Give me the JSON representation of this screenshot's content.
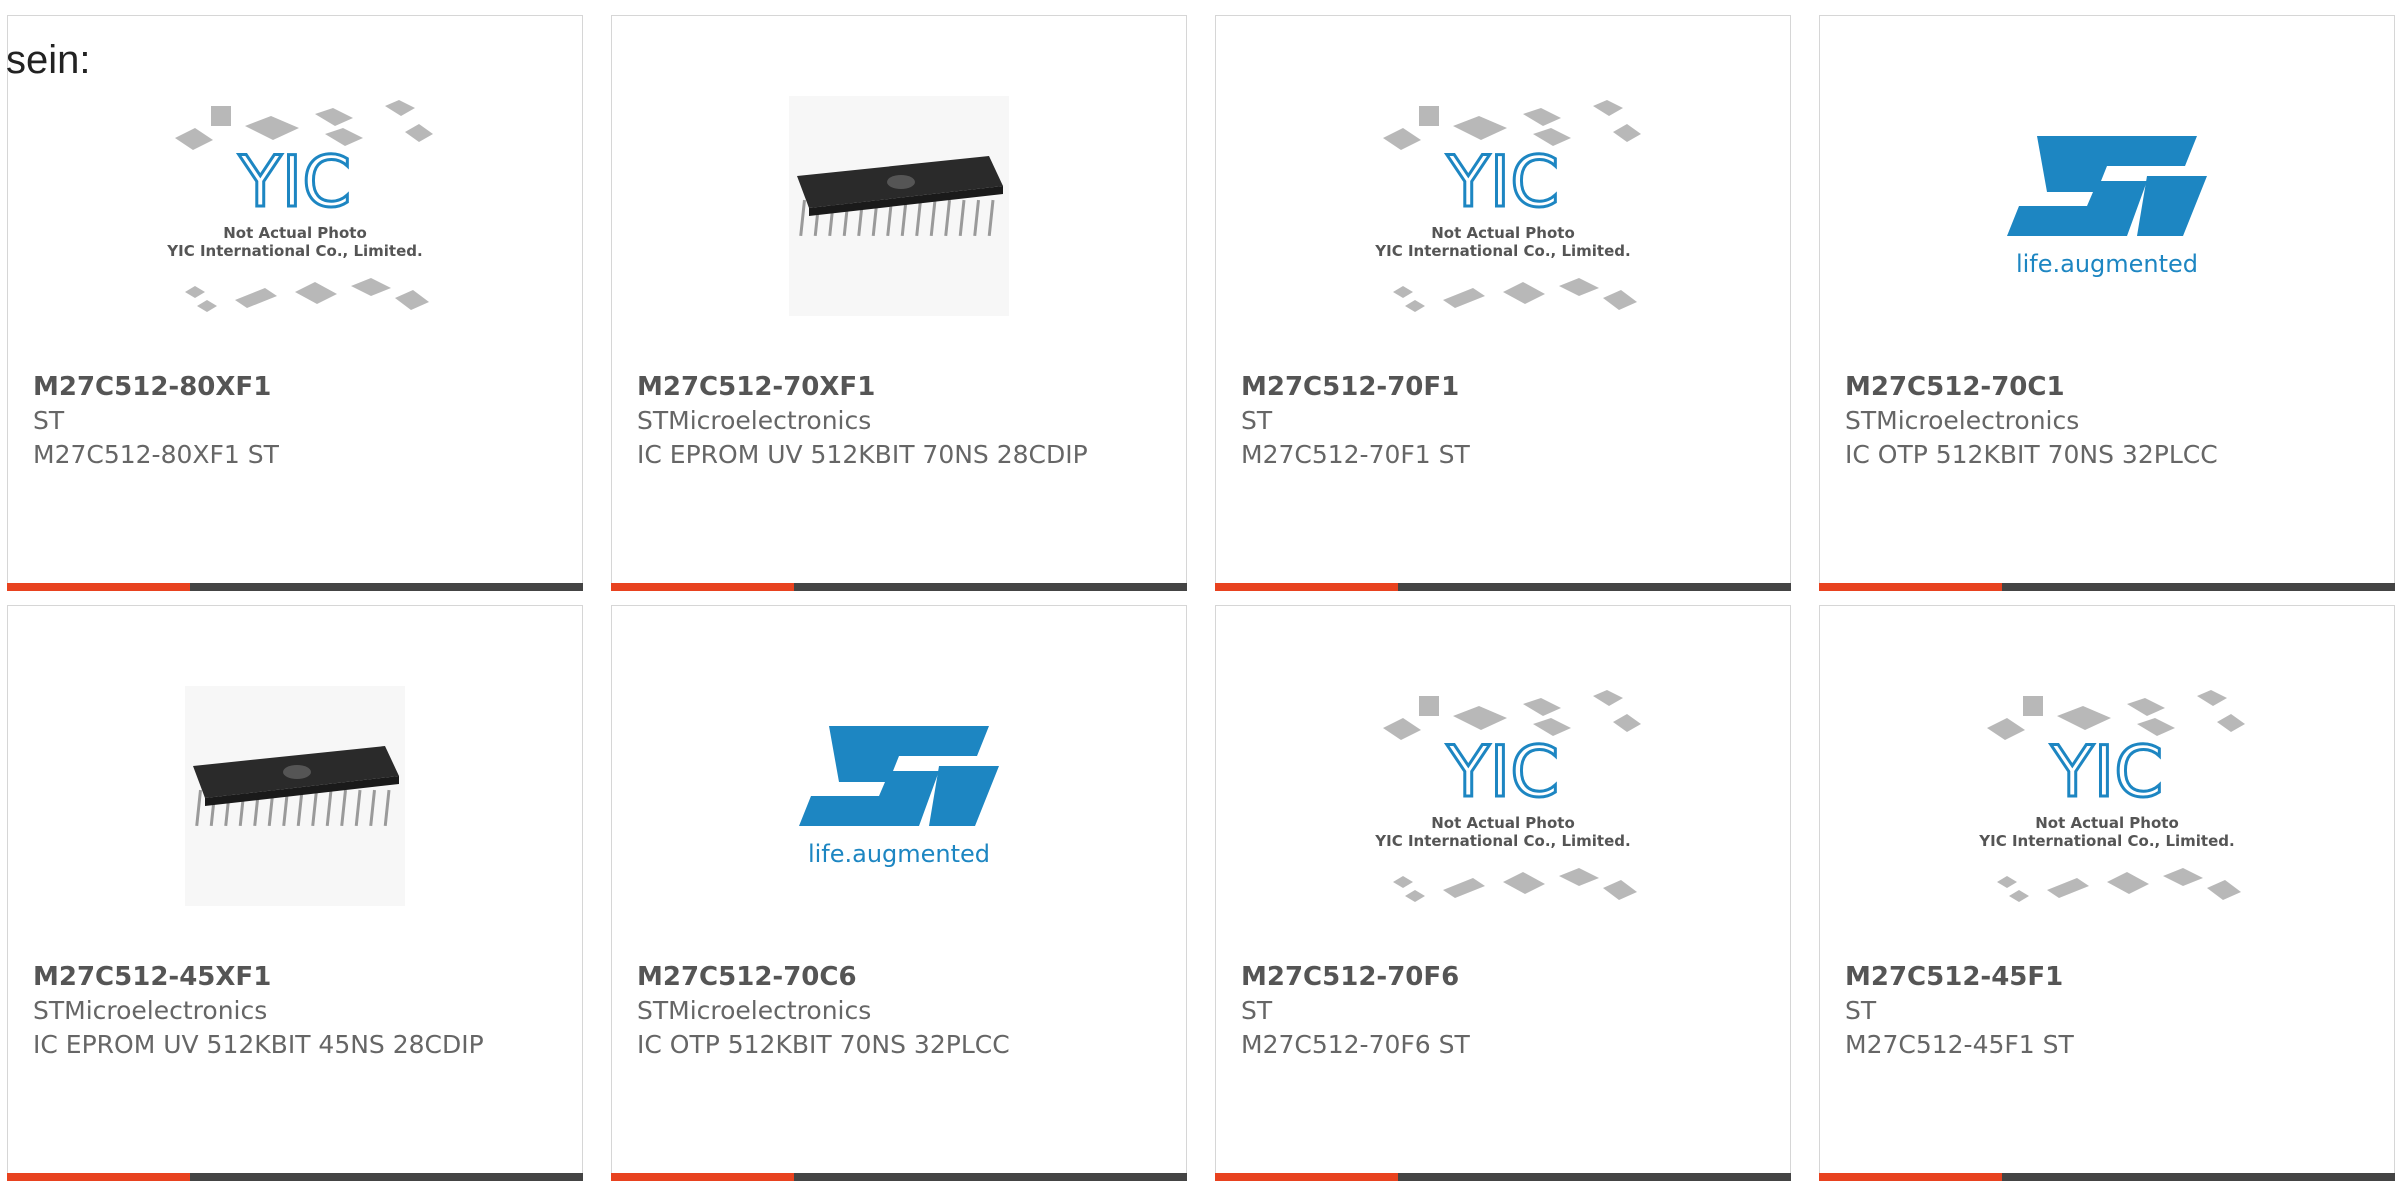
{
  "heading": "sein:",
  "colors": {
    "accent": "#e8421f",
    "bar": "#444444",
    "st_blue": "#1d86c2"
  },
  "products": [
    {
      "part_number": "M27C512-80XF1",
      "manufacturer": "ST",
      "description": "M27C512-80XF1 ST",
      "image": "placeholder",
      "image_text": [
        "Not Actual Photo",
        "YIC International Co., Limited."
      ]
    },
    {
      "part_number": "M27C512-70XF1",
      "manufacturer": "STMicroelectronics",
      "description": "IC EPROM UV 512KBIT 70NS 28CDIP",
      "image": "chip"
    },
    {
      "part_number": "M27C512-70F1",
      "manufacturer": "ST",
      "description": "M27C512-70F1 ST",
      "image": "placeholder",
      "image_text": [
        "Not Actual Photo",
        "YIC International Co., Limited."
      ]
    },
    {
      "part_number": "M27C512-70C1",
      "manufacturer": "STMicroelectronics",
      "description": "IC OTP 512KBIT 70NS 32PLCC",
      "image": "st_logo",
      "image_text": [
        "life.augmented"
      ]
    },
    {
      "part_number": "M27C512-45XF1",
      "manufacturer": "STMicroelectronics",
      "description": "IC EPROM UV 512KBIT 45NS 28CDIP",
      "image": "chip"
    },
    {
      "part_number": "M27C512-70C6",
      "manufacturer": "STMicroelectronics",
      "description": "IC OTP 512KBIT 70NS 32PLCC",
      "image": "st_logo",
      "image_text": [
        "life.augmented"
      ]
    },
    {
      "part_number": "M27C512-70F6",
      "manufacturer": "ST",
      "description": "M27C512-70F6 ST",
      "image": "placeholder",
      "image_text": [
        "Not Actual Photo",
        "YIC International Co., Limited."
      ]
    },
    {
      "part_number": "M27C512-45F1",
      "manufacturer": "ST",
      "description": "M27C512-45F1 ST",
      "image": "placeholder",
      "image_text": [
        "Not Actual Photo",
        "YIC International Co., Limited."
      ]
    }
  ]
}
